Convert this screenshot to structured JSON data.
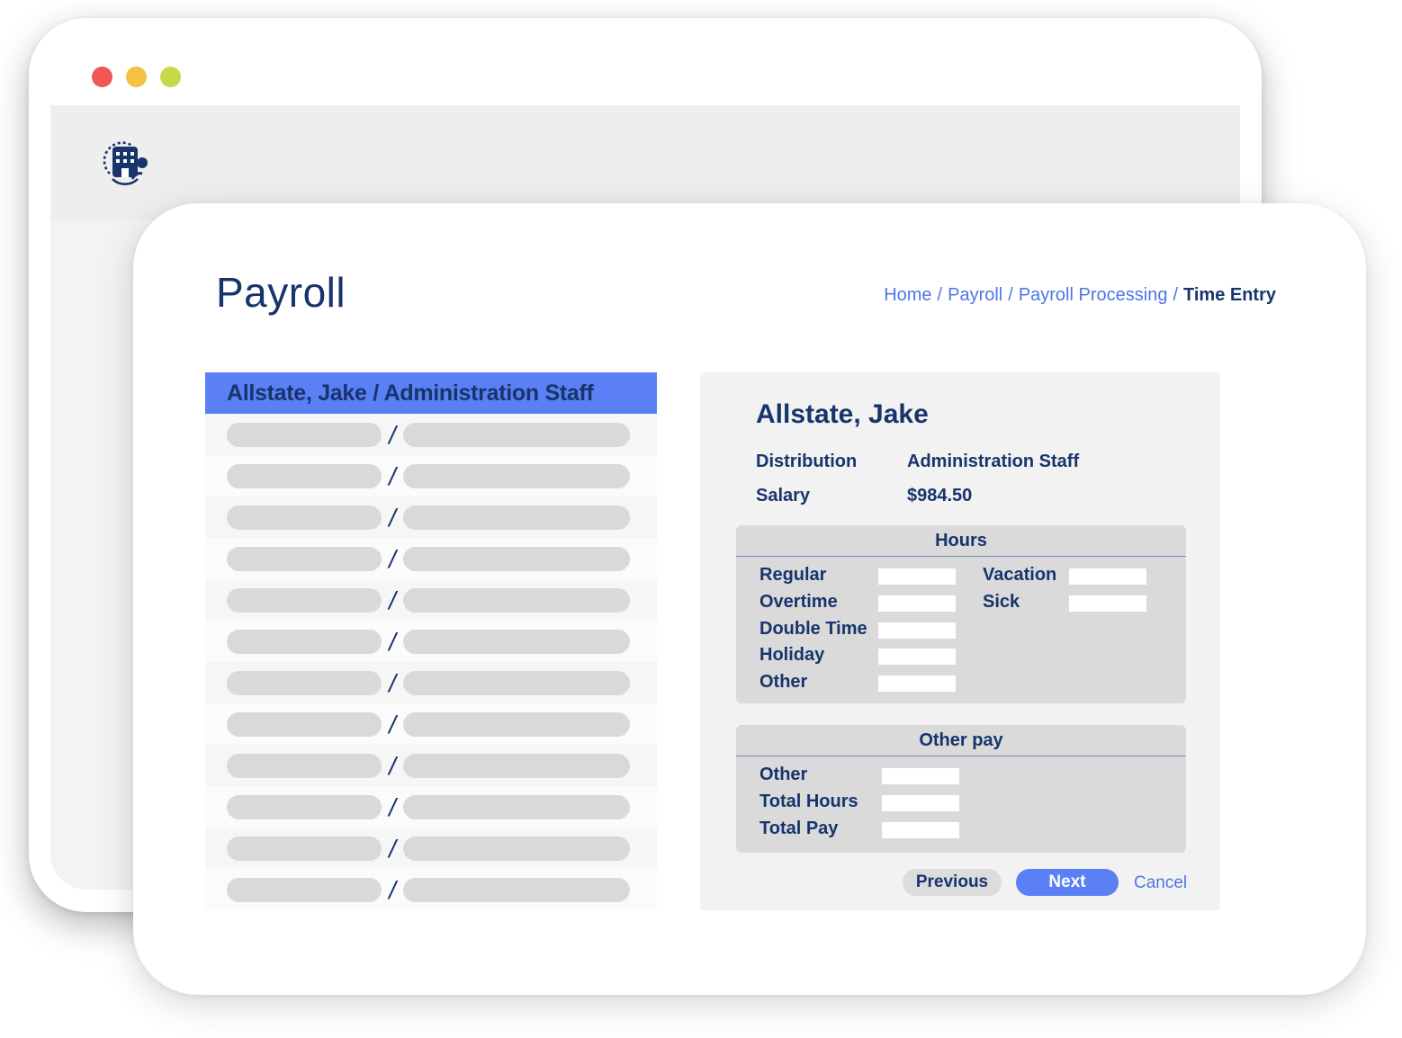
{
  "window": {
    "controls": [
      {
        "name": "close",
        "color": "#f25757"
      },
      {
        "name": "minimize",
        "color": "#f4c145"
      },
      {
        "name": "maximize",
        "color": "#c7d94a"
      }
    ]
  },
  "header": {
    "logo_icon": "building-logo-icon"
  },
  "page": {
    "title": "Payroll",
    "breadcrumb": [
      {
        "label": "Home"
      },
      {
        "label": "Payroll"
      },
      {
        "label": "Payroll Processing"
      }
    ],
    "breadcrumb_current": "Time Entry",
    "breadcrumb_separator": "/"
  },
  "employee_list": {
    "selected": "Allstate, Jake / Administration Staff",
    "separator": "/",
    "row_count": 12
  },
  "detail": {
    "name": "Allstate, Jake",
    "distribution_label": "Distribution",
    "distribution_value": "Administration Staff",
    "salary_label": "Salary",
    "salary_value": "$984.50",
    "hours": {
      "title": "Hours",
      "left_fields": [
        "Regular",
        "Overtime",
        "Double Time",
        "Holiday",
        "Other"
      ],
      "right_fields": [
        "Vacation",
        "Sick"
      ]
    },
    "other_pay": {
      "title": "Other pay",
      "fields": [
        "Other",
        "Total Hours",
        "Total Pay"
      ]
    },
    "buttons": {
      "previous": "Previous",
      "next": "Next",
      "cancel": "Cancel"
    }
  },
  "colors": {
    "accent": "#5b7ff5",
    "link": "#4e76e6",
    "text": "#17346b"
  }
}
